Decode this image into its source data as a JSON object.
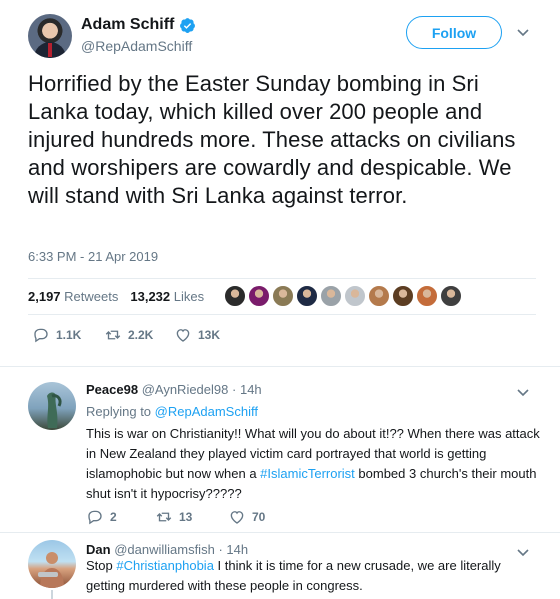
{
  "main_tweet": {
    "author_name": "Adam Schiff",
    "author_handle": "@RepAdamSchiff",
    "follow_label": "Follow",
    "text": "Horrified by the Easter Sunday bombing in Sri Lanka today, which killed over 200 people and injured hundreds more. These attacks on civilians and worshipers are cowardly and despicable. We will stand with Sri Lanka against terror.",
    "timestamp": "6:33 PM - 21 Apr 2019",
    "retweets_count": "2,197",
    "retweets_label": "Retweets",
    "likes_count": "13,232",
    "likes_label": "Likes",
    "reply_count": "1.1K",
    "retweet_count_short": "2.2K",
    "like_count_short": "13K",
    "liker_avatar_colors": [
      "#2b2b2b",
      "#7a1c6b",
      "#8a7a55",
      "#1e2a44",
      "#9aa2a8",
      "#c0c6cc",
      "#b47a4c",
      "#5c3d22",
      "#c46c3a",
      "#3f3f3f"
    ]
  },
  "replies": [
    {
      "name": "Peace98",
      "handle": "@AynRiedel98",
      "separator": "·",
      "time": "14h",
      "replying_to_label": "Replying to",
      "replying_to_mention": "@RepAdamSchiff",
      "text_before": "This is war on Christianity!! What will you do about it!?? When there was attack in New Zealand they played victim card portrayed that world is getting islamophobic but now when a ",
      "hashtag": "#IslamicTerrorist",
      "text_after": " bombed 3 church's their mouth shut isn't it hypocrisy?????",
      "reply_count": "2",
      "retweet_count": "13",
      "like_count": "70"
    },
    {
      "name": "Dan",
      "handle": "@danwilliamsfish",
      "separator": "·",
      "time": "14h",
      "text_before": "Stop ",
      "hashtag": "#Christianphobia",
      "text_after": " I think it is time for a new crusade, we are literally getting murdered with these people in congress."
    }
  ],
  "colors": {
    "accent": "#1da1f2",
    "text": "#14171a",
    "muted": "#657786",
    "divider": "#e6ecf0"
  }
}
